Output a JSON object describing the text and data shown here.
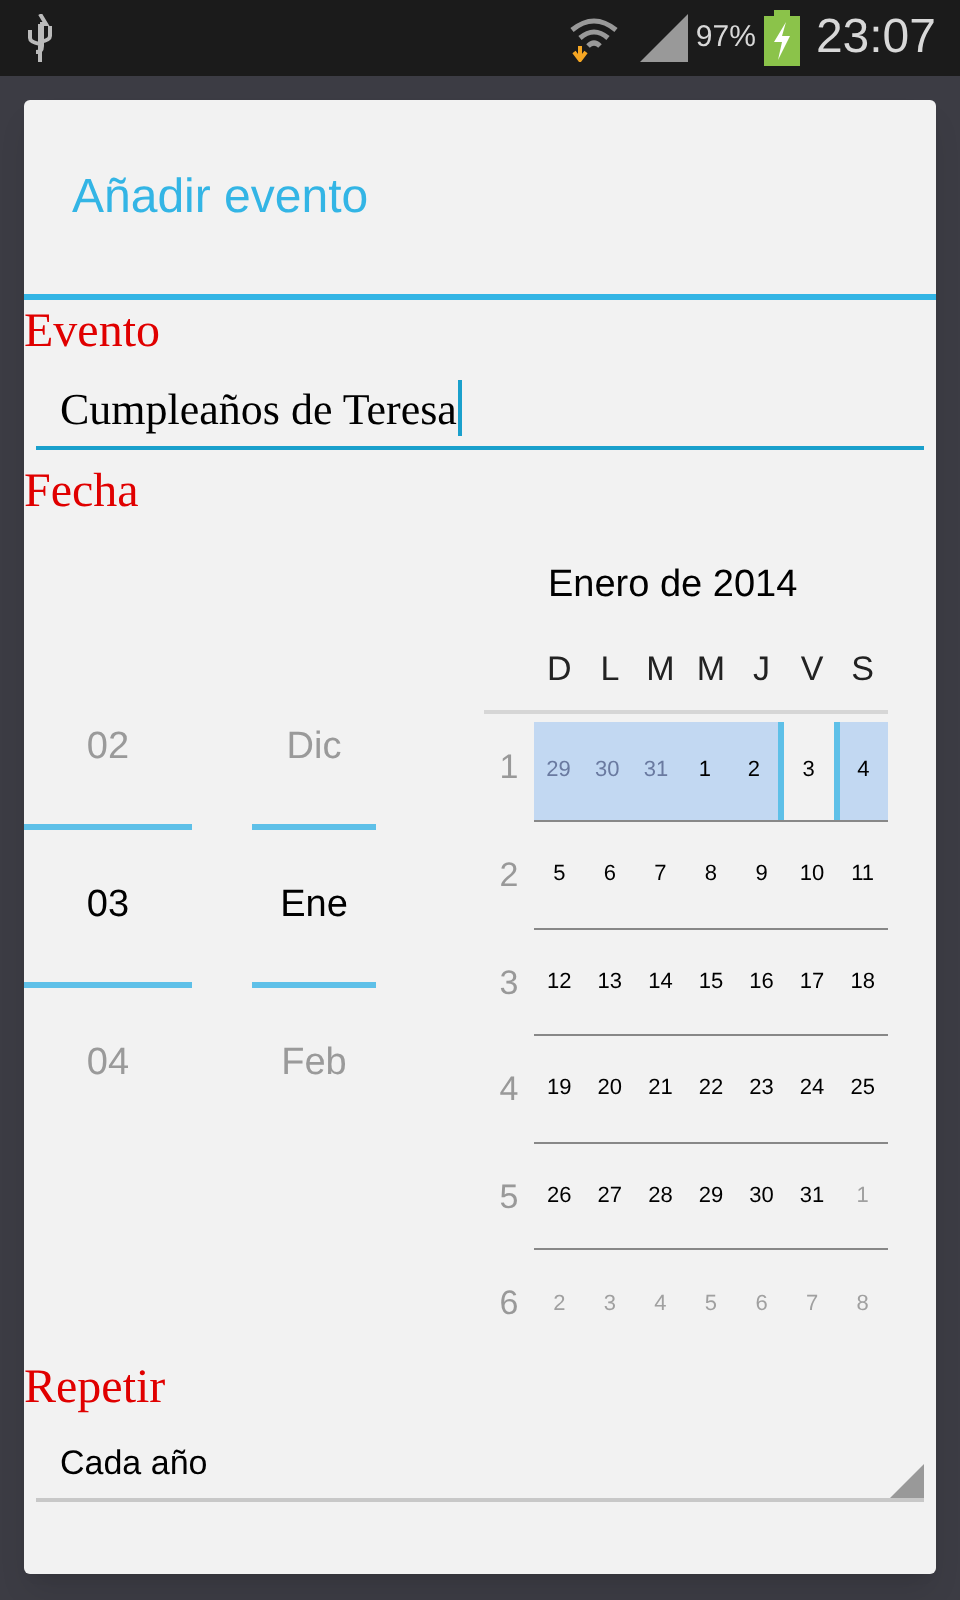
{
  "status_bar": {
    "battery": "97%",
    "time": "23:07"
  },
  "dialog": {
    "title": "Añadir evento",
    "event": {
      "label": "Evento",
      "value": "Cumpleaños de Teresa",
      "focused": true
    },
    "date": {
      "label": "Fecha",
      "day_picker": [
        {
          "label": "02",
          "selected": false
        },
        {
          "label": "03",
          "selected": true
        },
        {
          "label": "04",
          "selected": false
        }
      ],
      "month_picker": [
        {
          "label": "Dic",
          "selected": false
        },
        {
          "label": "Ene",
          "selected": true
        },
        {
          "label": "Feb",
          "selected": false
        }
      ],
      "calendar": {
        "title": "Enero de 2014",
        "weekdays": [
          "D",
          "L",
          "M",
          "M",
          "J",
          "V",
          "S"
        ],
        "weeks": [
          {
            "number": "1",
            "selected": true,
            "days": [
              {
                "label": "29",
                "in_month": false,
                "selected": false
              },
              {
                "label": "30",
                "in_month": false,
                "selected": false
              },
              {
                "label": "31",
                "in_month": false,
                "selected": false
              },
              {
                "label": "1",
                "in_month": true,
                "selected": false
              },
              {
                "label": "2",
                "in_month": true,
                "selected": false
              },
              {
                "label": "3",
                "in_month": true,
                "selected": true
              },
              {
                "label": "4",
                "in_month": true,
                "selected": false
              }
            ]
          },
          {
            "number": "2",
            "selected": false,
            "days": [
              {
                "label": "5",
                "in_month": true,
                "selected": false
              },
              {
                "label": "6",
                "in_month": true,
                "selected": false
              },
              {
                "label": "7",
                "in_month": true,
                "selected": false
              },
              {
                "label": "8",
                "in_month": true,
                "selected": false
              },
              {
                "label": "9",
                "in_month": true,
                "selected": false
              },
              {
                "label": "10",
                "in_month": true,
                "selected": false
              },
              {
                "label": "11",
                "in_month": true,
                "selected": false
              }
            ]
          },
          {
            "number": "3",
            "selected": false,
            "days": [
              {
                "label": "12",
                "in_month": true,
                "selected": false
              },
              {
                "label": "13",
                "in_month": true,
                "selected": false
              },
              {
                "label": "14",
                "in_month": true,
                "selected": false
              },
              {
                "label": "15",
                "in_month": true,
                "selected": false
              },
              {
                "label": "16",
                "in_month": true,
                "selected": false
              },
              {
                "label": "17",
                "in_month": true,
                "selected": false
              },
              {
                "label": "18",
                "in_month": true,
                "selected": false
              }
            ]
          },
          {
            "number": "4",
            "selected": false,
            "days": [
              {
                "label": "19",
                "in_month": true,
                "selected": false
              },
              {
                "label": "20",
                "in_month": true,
                "selected": false
              },
              {
                "label": "21",
                "in_month": true,
                "selected": false
              },
              {
                "label": "22",
                "in_month": true,
                "selected": false
              },
              {
                "label": "23",
                "in_month": true,
                "selected": false
              },
              {
                "label": "24",
                "in_month": true,
                "selected": false
              },
              {
                "label": "25",
                "in_month": true,
                "selected": false
              }
            ]
          },
          {
            "number": "5",
            "selected": false,
            "days": [
              {
                "label": "26",
                "in_month": true,
                "selected": false
              },
              {
                "label": "27",
                "in_month": true,
                "selected": false
              },
              {
                "label": "28",
                "in_month": true,
                "selected": false
              },
              {
                "label": "29",
                "in_month": true,
                "selected": false
              },
              {
                "label": "30",
                "in_month": true,
                "selected": false
              },
              {
                "label": "31",
                "in_month": true,
                "selected": false
              },
              {
                "label": "1",
                "in_month": false,
                "selected": false
              }
            ]
          },
          {
            "number": "6",
            "selected": false,
            "days": [
              {
                "label": "2",
                "in_month": false,
                "selected": false
              },
              {
                "label": "3",
                "in_month": false,
                "selected": false
              },
              {
                "label": "4",
                "in_month": false,
                "selected": false
              },
              {
                "label": "5",
                "in_month": false,
                "selected": false
              },
              {
                "label": "6",
                "in_month": false,
                "selected": false
              },
              {
                "label": "7",
                "in_month": false,
                "selected": false
              },
              {
                "label": "8",
                "in_month": false,
                "selected": false
              }
            ]
          }
        ]
      }
    },
    "repeat": {
      "label": "Repetir",
      "value": "Cada año"
    }
  }
}
